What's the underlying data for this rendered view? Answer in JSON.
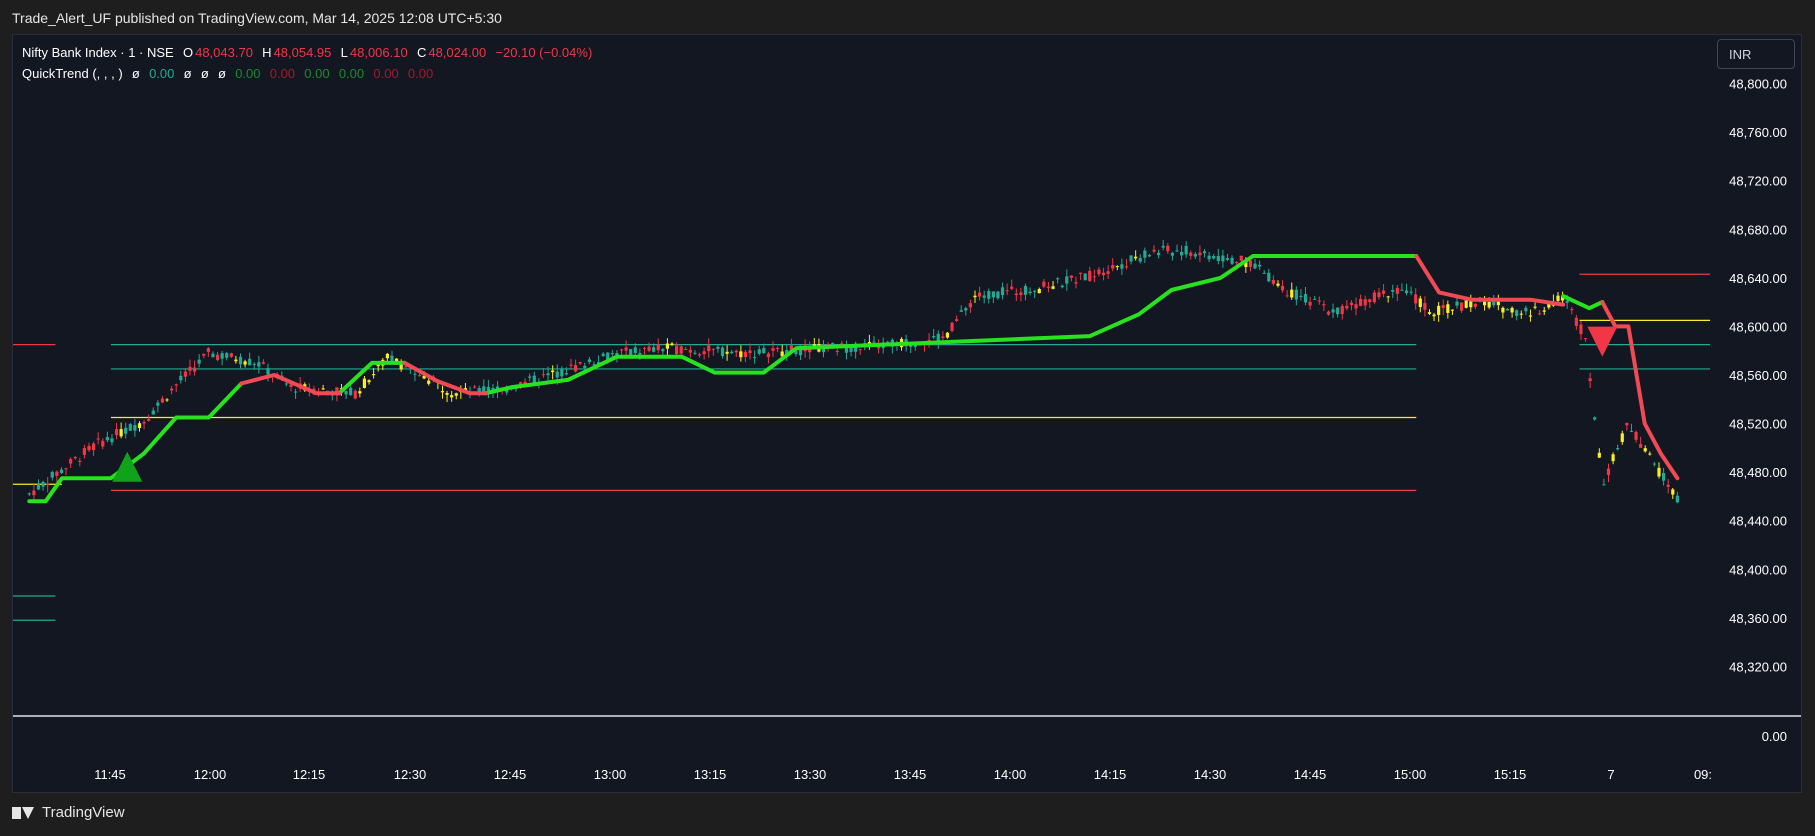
{
  "header": {
    "publish_line": "Trade_Alert_UF published on TradingView.com, Mar 14, 2025 12:08 UTC+5:30"
  },
  "legend": {
    "symbol": "Nifty Bank Index · 1 · NSE",
    "open_label": "O",
    "open": "48,043.70",
    "high_label": "H",
    "high": "48,054.95",
    "low_label": "L",
    "low": "48,006.10",
    "close_label": "C",
    "close": "48,024.00",
    "change": "−20.10 (−0.04%)",
    "indicator_name": "QuickTrend (, , , )",
    "ind_values": [
      "ø",
      "0.00",
      "ø",
      "ø",
      "ø",
      "0.00",
      "0.00",
      "0.00",
      "0.00",
      "0.00",
      "0.00"
    ]
  },
  "currency_button": "INR",
  "footer": {
    "brand": "TradingView"
  },
  "colors": {
    "background": "#131722",
    "bull": "#22ab94",
    "bear": "#f23645",
    "neutral": "#fcee21",
    "trend_up": "#29e21f",
    "trend_down": "#f24a55"
  },
  "chart_data": {
    "type": "candlestick",
    "title": "Nifty Bank Index · 1 · NSE",
    "y_axis": {
      "ylim": [
        48280,
        48840
      ],
      "ticks": [
        48800,
        48760,
        48720,
        48680,
        48640,
        48600,
        48560,
        48520,
        48480,
        48440,
        48400,
        48360,
        48320
      ],
      "tick_labels": [
        "48,800.00",
        "48,760.00",
        "48,720.00",
        "48,680.00",
        "48,640.00",
        "48,600.00",
        "48,560.00",
        "48,520.00",
        "48,480.00",
        "48,440.00",
        "48,400.00",
        "48,360.00",
        "48,320.00"
      ]
    },
    "x_axis": {
      "tick_labels": [
        "11:45",
        "12:00",
        "12:15",
        "12:30",
        "12:45",
        "13:00",
        "13:15",
        "13:30",
        "13:45",
        "14:00",
        "14:15",
        "14:30",
        "14:45",
        "15:00",
        "15:15",
        "7",
        "09:"
      ]
    },
    "indicator_pane": {
      "tick_label": "0.00"
    },
    "price_path": [
      [
        11.3,
        48462
      ],
      [
        11.5,
        48502
      ],
      [
        11.65,
        48522
      ],
      [
        11.75,
        48552
      ],
      [
        11.85,
        48578
      ],
      [
        12.0,
        48570
      ],
      [
        12.1,
        48550
      ],
      [
        12.3,
        48545
      ],
      [
        12.4,
        48575
      ],
      [
        12.6,
        48545
      ],
      [
        12.75,
        48548
      ],
      [
        12.9,
        48560
      ],
      [
        13.1,
        48578
      ],
      [
        13.25,
        48582
      ],
      [
        13.5,
        48578
      ],
      [
        13.75,
        48582
      ],
      [
        13.9,
        48584
      ],
      [
        14.1,
        48590
      ],
      [
        14.2,
        48625
      ],
      [
        14.4,
        48632
      ],
      [
        14.55,
        48642
      ],
      [
        14.75,
        48662
      ],
      [
        14.85,
        48662
      ],
      [
        15.05,
        48652
      ],
      [
        15.15,
        48630
      ],
      [
        15.3,
        48612
      ],
      [
        15.5,
        48632
      ],
      [
        15.6,
        48612
      ],
      [
        15.75,
        48620
      ],
      [
        15.9,
        48610
      ],
      [
        16.0,
        48625
      ],
      [
        16.07,
        48590
      ],
      [
        16.12,
        48470
      ],
      [
        16.2,
        48520
      ],
      [
        16.27,
        48490
      ],
      [
        16.35,
        48458
      ]
    ],
    "trend_line": {
      "up_segments": [
        [
          [
            11.3,
            48456
          ],
          [
            11.35,
            48456
          ],
          [
            11.4,
            48475
          ],
          [
            11.55,
            48475
          ],
          [
            11.65,
            48495
          ],
          [
            11.75,
            48525
          ],
          [
            11.85,
            48525
          ],
          [
            11.95,
            48553
          ]
        ],
        [
          [
            12.25,
            48545
          ],
          [
            12.35,
            48570
          ],
          [
            12.45,
            48570
          ]
        ],
        [
          [
            12.7,
            48545
          ],
          [
            12.78,
            48550
          ],
          [
            12.95,
            48556
          ],
          [
            13.1,
            48575
          ],
          [
            13.3,
            48575
          ],
          [
            13.4,
            48562
          ],
          [
            13.55,
            48562
          ],
          [
            13.65,
            48582
          ],
          [
            14.55,
            48592
          ],
          [
            14.7,
            48610
          ],
          [
            14.8,
            48630
          ],
          [
            14.95,
            48640
          ],
          [
            15.05,
            48658
          ],
          [
            15.55,
            48658
          ]
        ],
        [
          [
            16.0,
            48625
          ],
          [
            16.08,
            48615
          ],
          [
            16.12,
            48620
          ]
        ]
      ],
      "down_segments": [
        [
          [
            11.95,
            48553
          ],
          [
            12.05,
            48560
          ],
          [
            12.18,
            48545
          ],
          [
            12.25,
            48545
          ]
        ],
        [
          [
            12.45,
            48570
          ],
          [
            12.55,
            48555
          ],
          [
            12.65,
            48545
          ],
          [
            12.7,
            48545
          ]
        ],
        [
          [
            15.55,
            48658
          ],
          [
            15.62,
            48628
          ],
          [
            15.72,
            48622
          ],
          [
            15.78,
            48622
          ],
          [
            15.9,
            48622
          ],
          [
            16.0,
            48618
          ]
        ],
        [
          [
            16.12,
            48620
          ],
          [
            16.16,
            48600
          ],
          [
            16.2,
            48600
          ],
          [
            16.25,
            48520
          ],
          [
            16.3,
            48495
          ],
          [
            16.35,
            48475
          ]
        ]
      ]
    },
    "horizontal_levels": [
      {
        "price": 48585,
        "color": "#22ab94",
        "from": 11.55,
        "to": 15.55
      },
      {
        "price": 48565,
        "color": "#22ab94",
        "from": 11.55,
        "to": 15.55
      },
      {
        "price": 48525,
        "color": "#fcee21",
        "from": 11.55,
        "to": 15.55
      },
      {
        "price": 48465,
        "color": "#f23645",
        "from": 11.55,
        "to": 15.55
      },
      {
        "price": 48585,
        "color": "#f23645",
        "from": 11.25,
        "to": 11.38
      },
      {
        "price": 48470,
        "color": "#fcee21",
        "from": 11.25,
        "to": 11.4
      },
      {
        "price": 48378,
        "color": "#22ab94",
        "from": 11.25,
        "to": 11.38
      },
      {
        "price": 48358,
        "color": "#22ab94",
        "from": 11.25,
        "to": 11.38
      },
      {
        "price": 48643,
        "color": "#f23645",
        "from": 16.05,
        "to": 16.45
      },
      {
        "price": 48605,
        "color": "#fcee21",
        "from": 16.05,
        "to": 16.45
      },
      {
        "price": 48585,
        "color": "#22ab94",
        "from": 16.05,
        "to": 16.45
      },
      {
        "price": 48565,
        "color": "#22ab94",
        "from": 16.05,
        "to": 16.45
      }
    ],
    "signals": [
      {
        "type": "buy",
        "x": 11.6,
        "price": 48482
      },
      {
        "type": "sell",
        "x": 16.12,
        "price": 48590
      }
    ]
  }
}
